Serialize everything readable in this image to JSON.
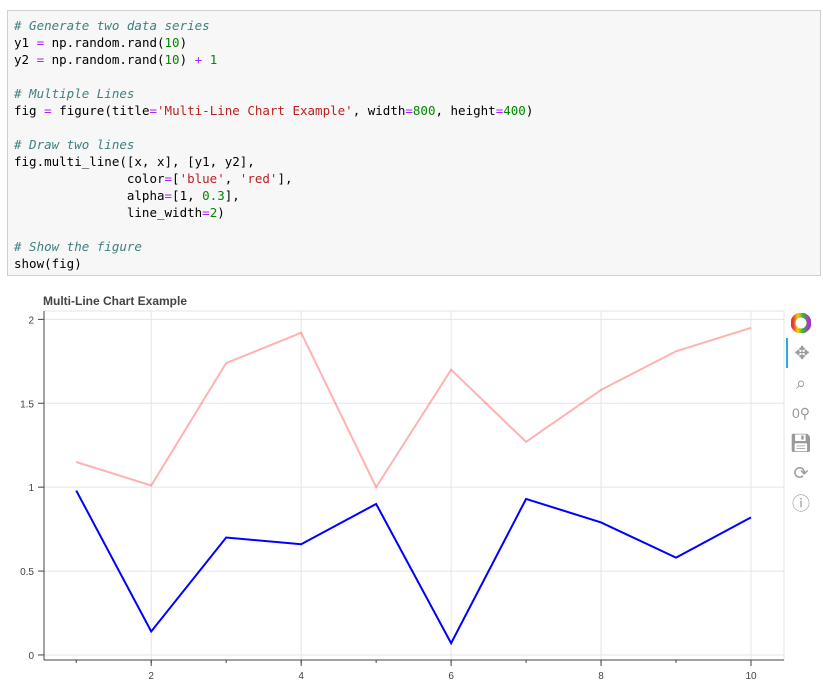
{
  "code_lines": [
    [
      [
        "c",
        "# Generate two data series"
      ]
    ],
    [
      [
        "",
        "y1 "
      ],
      [
        "o",
        "="
      ],
      [
        "",
        " np.random.rand("
      ],
      [
        "n",
        "10"
      ],
      [
        "",
        ")"
      ]
    ],
    [
      [
        "",
        "y2 "
      ],
      [
        "o",
        "="
      ],
      [
        "",
        " np.random.rand("
      ],
      [
        "n",
        "10"
      ],
      [
        "",
        ") "
      ],
      [
        "o",
        "+"
      ],
      [
        "n",
        " 1"
      ]
    ],
    [
      [
        "",
        ""
      ]
    ],
    [
      [
        "c",
        "# Multiple Lines"
      ]
    ],
    [
      [
        "",
        "fig "
      ],
      [
        "o",
        "="
      ],
      [
        "",
        " figure(title"
      ],
      [
        "o",
        "="
      ],
      [
        "s",
        "'Multi-Line Chart Example'"
      ],
      [
        "",
        ", width"
      ],
      [
        "o",
        "="
      ],
      [
        "n",
        "800"
      ],
      [
        "",
        ", height"
      ],
      [
        "o",
        "="
      ],
      [
        "n",
        "400"
      ],
      [
        "",
        ")"
      ]
    ],
    [
      [
        "",
        ""
      ]
    ],
    [
      [
        "c",
        "# Draw two lines"
      ]
    ],
    [
      [
        "",
        "fig.multi_line([x, x], [y1, y2],"
      ]
    ],
    [
      [
        "",
        "               color"
      ],
      [
        "o",
        "="
      ],
      [
        "",
        "["
      ],
      [
        "s",
        "'blue'"
      ],
      [
        "",
        ", "
      ],
      [
        "s",
        "'red'"
      ],
      [
        "",
        "],"
      ]
    ],
    [
      [
        "",
        "               alpha"
      ],
      [
        "o",
        "="
      ],
      [
        "",
        "[1, "
      ],
      [
        "n",
        "0.3"
      ],
      [
        "",
        "],"
      ]
    ],
    [
      [
        "",
        "               line_width"
      ],
      [
        "o",
        "="
      ],
      [
        "n",
        "2"
      ],
      [
        "",
        ")"
      ]
    ],
    [
      [
        "",
        ""
      ]
    ],
    [
      [
        "c",
        "# Show the figure"
      ]
    ],
    [
      [
        "",
        "show(fig)"
      ]
    ]
  ],
  "toolbar": [
    "bokeh-logo",
    "pan-icon",
    "box-zoom-icon",
    "wheel-zoom-icon",
    "save-icon",
    "reset-icon",
    "help-icon"
  ],
  "chart_data": {
    "type": "line",
    "title": "Multi-Line Chart Example",
    "x": [
      1,
      2,
      3,
      4,
      5,
      6,
      7,
      8,
      9,
      10
    ],
    "series": [
      {
        "name": "y1",
        "color": "#0000ff",
        "alpha": 1,
        "values": [
          0.98,
          0.14,
          0.7,
          0.66,
          0.9,
          0.07,
          0.93,
          0.79,
          0.58,
          0.82
        ]
      },
      {
        "name": "y2",
        "color": "#ff0000",
        "alpha": 0.3,
        "values": [
          1.15,
          1.01,
          1.74,
          1.92,
          1.0,
          1.7,
          1.27,
          1.58,
          1.81,
          1.95
        ]
      }
    ],
    "xlim": [
      0.57,
      10.44
    ],
    "ylim": [
      -0.03,
      2.05
    ],
    "xticks": [
      2,
      4,
      6,
      8,
      10
    ],
    "yticks": [
      0,
      0.5,
      1,
      1.5,
      2
    ],
    "xtick_labels": [
      "2",
      "4",
      "6",
      "8",
      "10"
    ],
    "ytick_labels": [
      "0",
      "0.5",
      "1",
      "1.5",
      "2"
    ],
    "grid": true
  }
}
